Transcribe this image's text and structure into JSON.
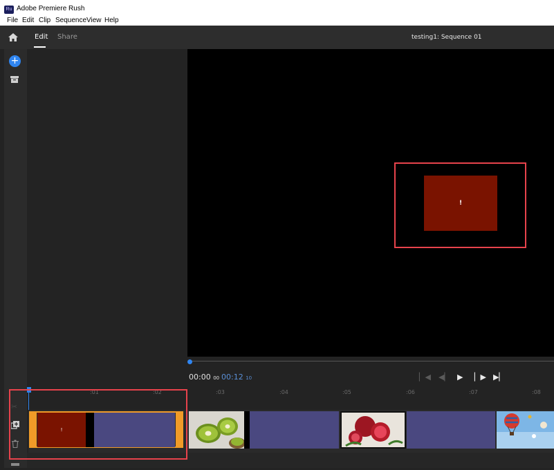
{
  "window": {
    "app_title": "Adobe Premiere Rush",
    "logo_text": "Ru"
  },
  "menubar": {
    "items": [
      "File",
      "Edit",
      "Clip",
      "Sequence",
      "View",
      "Help"
    ]
  },
  "topbar": {
    "tabs": {
      "edit": "Edit",
      "share": "Share"
    },
    "sequence_title": "testing1: Sequence 01"
  },
  "sidebar": {
    "add_label": "+"
  },
  "viewer": {
    "frame_text": "!"
  },
  "playback": {
    "current_time": "00:00",
    "current_frames": "00",
    "total_time": "00:12",
    "total_frames": "10",
    "progress": 0.0
  },
  "timeline": {
    "ruler_ticks": [
      ":01",
      ":02",
      ":03",
      ":04",
      ":05",
      ":06",
      ":07",
      ":08"
    ],
    "selected_clip_text": "!",
    "clips": [
      "red-frame-clip",
      "kiwi-clip",
      "pomegranate-clip",
      "balloons-clip"
    ]
  },
  "colors": {
    "accent": "#2f85f0",
    "selection": "#f09b28",
    "highlight": "#e8434c",
    "clip_purple": "#4a4880",
    "clip_red": "#7a1300"
  }
}
